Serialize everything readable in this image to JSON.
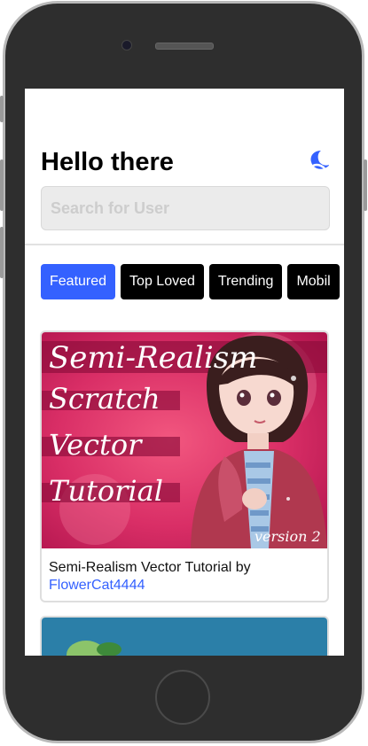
{
  "header": {
    "greeting": "Hello there",
    "theme_icon": "moon-icon"
  },
  "search": {
    "placeholder": "Search for User",
    "value": ""
  },
  "tabs": [
    {
      "label": "Featured",
      "active": true
    },
    {
      "label": "Top Loved",
      "active": false
    },
    {
      "label": "Trending",
      "active": false
    },
    {
      "label": "Mobil",
      "active": false
    }
  ],
  "projects": [
    {
      "thumbnail_text": {
        "line1": "Semi-Realism",
        "line2": "Scratch",
        "line3": "Vector",
        "line4": "Tutorial",
        "badge": "version 2"
      },
      "title_prefix": "Semi-Realism Vector Tutorial by",
      "author": "FlowerCat4444"
    }
  ],
  "colors": {
    "accent": "#3461ff",
    "tab_inactive": "#000000",
    "search_bg": "#ebebeb"
  }
}
